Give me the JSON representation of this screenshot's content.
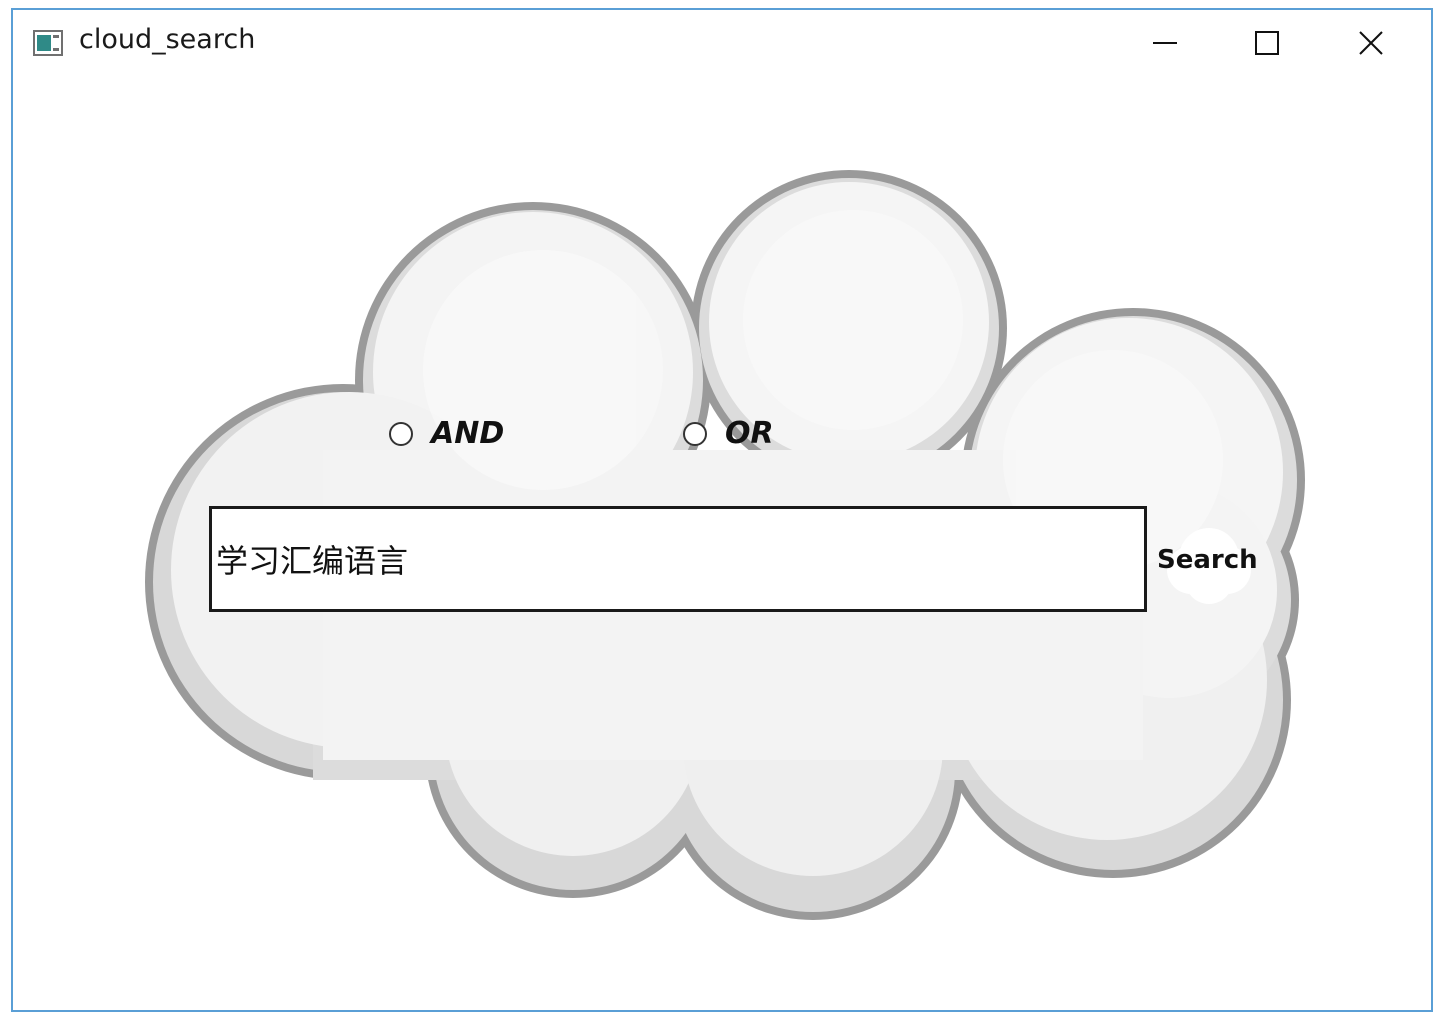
{
  "window": {
    "title": "cloud_search",
    "controls": {
      "minimize_icon": "minimize-icon",
      "maximize_icon": "maximize-icon",
      "close_icon": "close-icon"
    }
  },
  "options": {
    "and_label": "AND",
    "or_label": "OR",
    "selected": null
  },
  "search": {
    "value": "学习汇编语言",
    "button_label": "Search"
  },
  "colors": {
    "window_border": "#5a9fd6",
    "cloud_outline": "#9a9a9a",
    "cloud_fill": "#f5f5f5",
    "cloud_shade": "#e2e2e2"
  }
}
